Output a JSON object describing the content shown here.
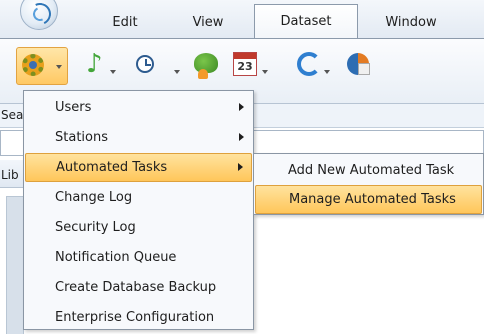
{
  "menu_bar": {
    "tabs": [
      {
        "label": "Edit"
      },
      {
        "label": "View"
      },
      {
        "label": "Dataset",
        "selected": true
      },
      {
        "label": "Window"
      }
    ]
  },
  "ribbon": {
    "buttons": [
      {
        "icon": "gear-icon",
        "active": true
      },
      {
        "icon": "music-note-icon"
      },
      {
        "icon": "clock-icon"
      },
      {
        "icon": "tree-fire-icon"
      },
      {
        "icon": "calendar-icon",
        "text": "23"
      },
      {
        "icon": "sync-icon"
      },
      {
        "icon": "pie-chart-icon"
      }
    ]
  },
  "panels": {
    "search_label": "Sea",
    "library_label": "Lib"
  },
  "tools_menu": {
    "items": [
      {
        "label": "Users",
        "has_submenu": true
      },
      {
        "label": "Stations",
        "has_submenu": true
      },
      {
        "label": "Automated Tasks",
        "has_submenu": true,
        "active": true
      },
      {
        "label": "Change Log"
      },
      {
        "label": "Security Log"
      },
      {
        "label": "Notification Queue"
      },
      {
        "label": "Create Database Backup"
      },
      {
        "label": "Enterprise Configuration"
      }
    ]
  },
  "submenu": {
    "items": [
      {
        "label": "Add New Automated Task"
      },
      {
        "label": "Manage Automated Tasks",
        "active": true
      }
    ]
  },
  "colors": {
    "highlight": "#ffc65a",
    "highlight_border": "#dea13d",
    "menu_background": "#f7f9fc"
  }
}
